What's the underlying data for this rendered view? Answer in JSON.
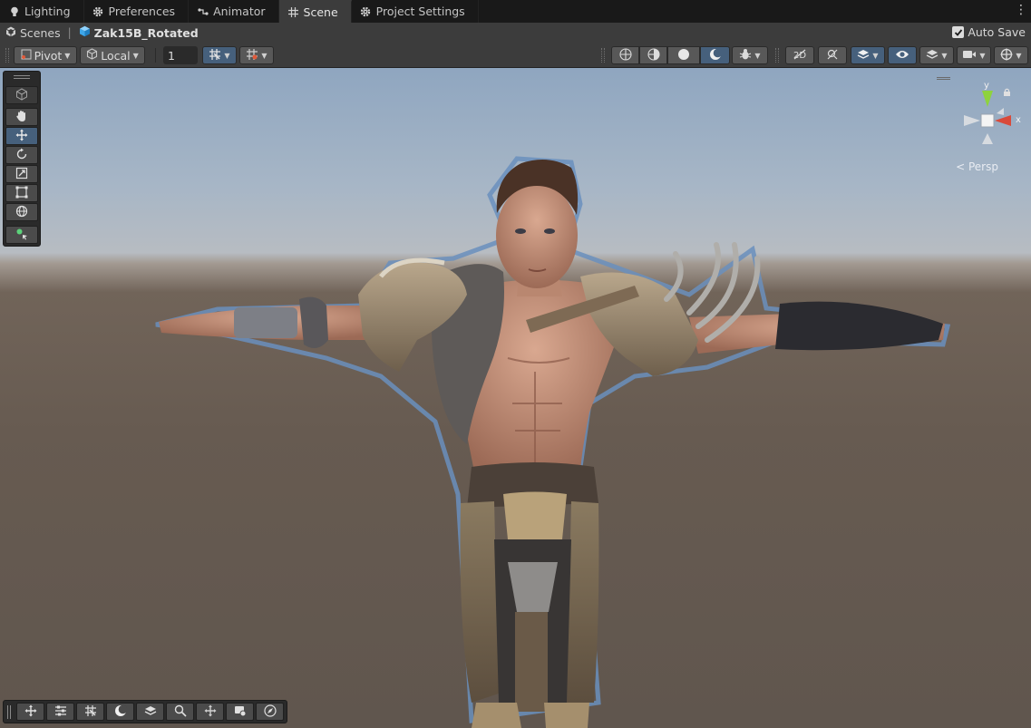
{
  "tabs": [
    {
      "label": "Lighting",
      "icon": "bulb-icon"
    },
    {
      "label": "Preferences",
      "icon": "gear-icon"
    },
    {
      "label": "Animator",
      "icon": "animator-icon"
    },
    {
      "label": "Scene",
      "icon": "grid-icon",
      "active": true
    },
    {
      "label": "Project Settings",
      "icon": "gear-icon"
    }
  ],
  "breadcrumb": {
    "root": "Scenes",
    "current": "Zak15B_Rotated"
  },
  "autosave": {
    "label": "Auto Save",
    "checked": true
  },
  "toolbar": {
    "pivot_label": "Pivot",
    "space_label": "Local",
    "grid_snap_value": "1"
  },
  "viewport": {
    "projection_label": "< Persp",
    "gizmo_axes": {
      "y": "y",
      "x": "x"
    }
  },
  "colors": {
    "panel": "#3c3c3c",
    "tab_bg": "#191919",
    "active_tool": "#46607c",
    "selection_outline": "#6a8fbd",
    "sky": "#8fa6c0",
    "ground": "#675b51",
    "axis_x": "#d94a3a",
    "axis_y": "#8ed33d"
  }
}
